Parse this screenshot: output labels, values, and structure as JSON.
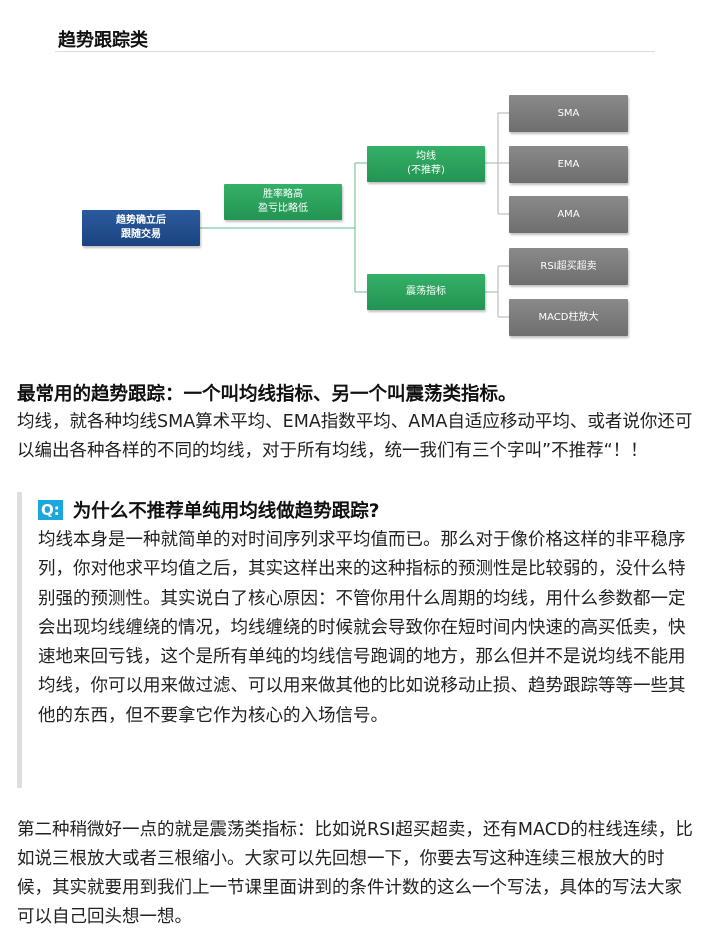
{
  "section": {
    "title": "趋势跟踪类"
  },
  "diagram": {
    "root": "趋势确立后\n跟随交易",
    "level1": "胜率略高\n盈亏比略低",
    "level2": [
      {
        "label": "均线\n(不推荐)",
        "children": [
          "SMA",
          "EMA",
          "AMA"
        ]
      },
      {
        "label": "震荡指标",
        "children": [
          "RSI超买超卖",
          "MACD柱放大"
        ]
      }
    ],
    "colors": {
      "root": "#1f4b8a",
      "mid": "#2da35f",
      "leaf": "#7a7a7a",
      "connector": "#7fc9a0"
    }
  },
  "content": {
    "heading": "最常用的趋势跟踪：一个叫均线指标、另一个叫震荡类指标。",
    "paragraph1": "均线，就各种均线SMA算术平均、EMA指数平均、AMA自适应移动平均、或者说你还可以编出各种各样的不同的均线，对于所有均线，统一我们有三个字叫”不推荐“！！",
    "qa": {
      "badge": "Q:",
      "question": "为什么不推荐单纯用均线做趋势跟踪?",
      "answer": "均线本身是一种就简单的对时间序列求平均值而已。那么对于像价格这样的非平稳序列，你对他求平均值之后，其实这样出来的这种指标的预测性是比较弱的，没什么特别强的预测性。其实说白了核心原因：不管你用什么周期的均线，用什么参数都一定会出现均线缠绕的情况，均线缠绕的时候就会导致你在短时间内快速的高买低卖，快速地来回亏钱，这个是所有单纯的均线信号跑调的地方，那么但并不是说均线不能用均线，你可以用来做过滤、可以用来做其他的比如说移动止损、趋势跟踪等等一些其他的东西，但不要拿它作为核心的入场信号。"
    },
    "paragraph2": "第二种稍微好一点的就是震荡类指标：比如说RSI超买超卖，还有MACD的柱线连续，比如说三根放大或者三根缩小。大家可以先回想一下，你要去写这种连续三根放大的时候，其实就要用到我们上一节课里面讲到的条件计数的这么一个写法，具体的写法大家可以自己回头想一想。"
  }
}
